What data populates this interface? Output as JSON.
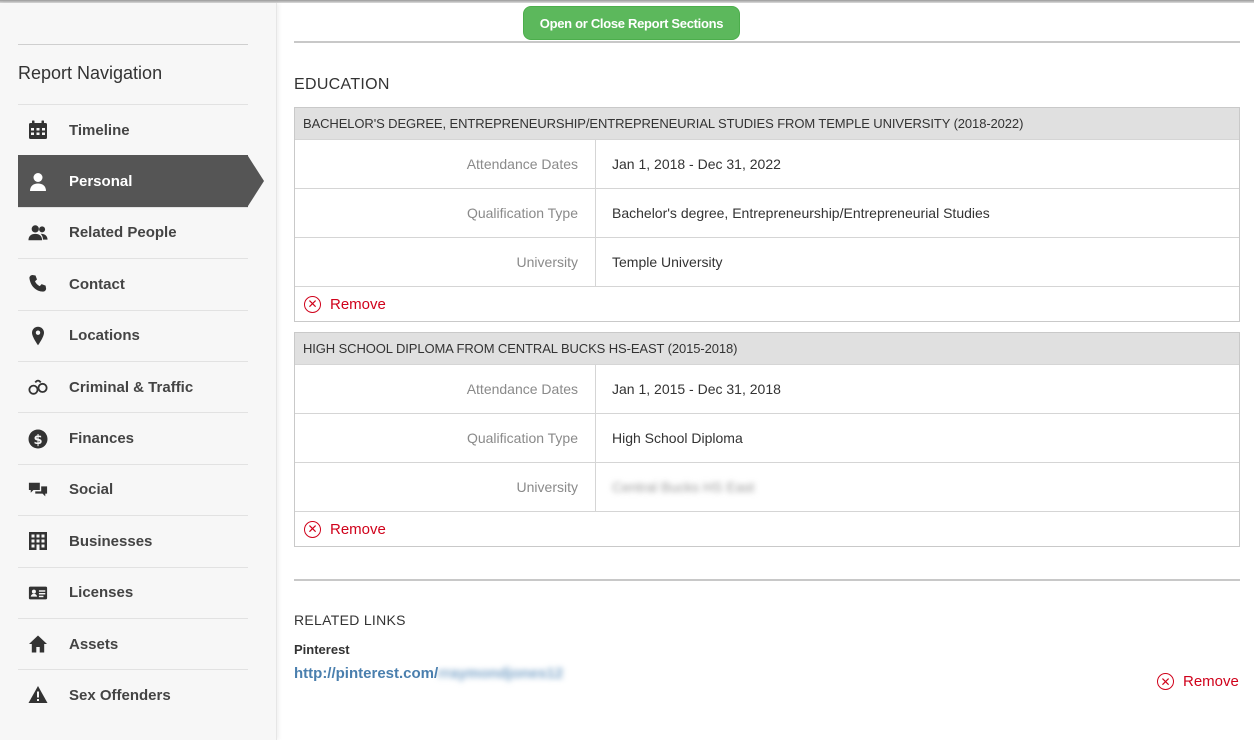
{
  "colors": {
    "accent_green": "#5cb85c",
    "active_nav": "#555555",
    "remove_red": "#d0021b",
    "link_blue": "#4a7fae"
  },
  "header": {
    "toggle_label": "Open or Close Report Sections"
  },
  "sidebar": {
    "title": "Report Navigation",
    "items": [
      {
        "label": "Timeline",
        "icon": "calendar-icon"
      },
      {
        "label": "Personal",
        "icon": "person-icon",
        "active": true
      },
      {
        "label": "Related People",
        "icon": "people-icon"
      },
      {
        "label": "Contact",
        "icon": "phone-icon"
      },
      {
        "label": "Locations",
        "icon": "map-pin-icon"
      },
      {
        "label": "Criminal & Traffic",
        "icon": "handcuffs-icon"
      },
      {
        "label": "Finances",
        "icon": "dollar-icon"
      },
      {
        "label": "Social",
        "icon": "chat-icon"
      },
      {
        "label": "Businesses",
        "icon": "building-icon"
      },
      {
        "label": "Licenses",
        "icon": "id-card-icon"
      },
      {
        "label": "Assets",
        "icon": "home-icon"
      },
      {
        "label": "Sex Offenders",
        "icon": "warning-icon"
      }
    ]
  },
  "education": {
    "title": "EDUCATION",
    "entries": [
      {
        "heading": "BACHELOR'S DEGREE, ENTREPRENEURSHIP/ENTREPRENEURIAL STUDIES FROM TEMPLE UNIVERSITY (2018-2022)",
        "rows": [
          {
            "label": "Attendance Dates",
            "value": "Jan 1, 2018 - Dec 31, 2022"
          },
          {
            "label": "Qualification Type",
            "value": "Bachelor's degree, Entrepreneurship/Entrepreneurial Studies"
          },
          {
            "label": "University",
            "value": "Temple University"
          }
        ],
        "remove_label": "Remove"
      },
      {
        "heading": "HIGH SCHOOL DIPLOMA FROM CENTRAL BUCKS HS-EAST (2015-2018)",
        "rows": [
          {
            "label": "Attendance Dates",
            "value": "Jan 1, 2015 - Dec 31, 2018"
          },
          {
            "label": "Qualification Type",
            "value": "High School Diploma"
          },
          {
            "label": "University",
            "value": "Central Bucks HS East"
          }
        ],
        "remove_label": "Remove"
      }
    ]
  },
  "related_links": {
    "title": "RELATED LINKS",
    "items": [
      {
        "label": "Pinterest",
        "url_prefix": "http://pinterest.com/",
        "url_hidden": "rraymondjones12",
        "remove_label": "Remove"
      }
    ]
  }
}
